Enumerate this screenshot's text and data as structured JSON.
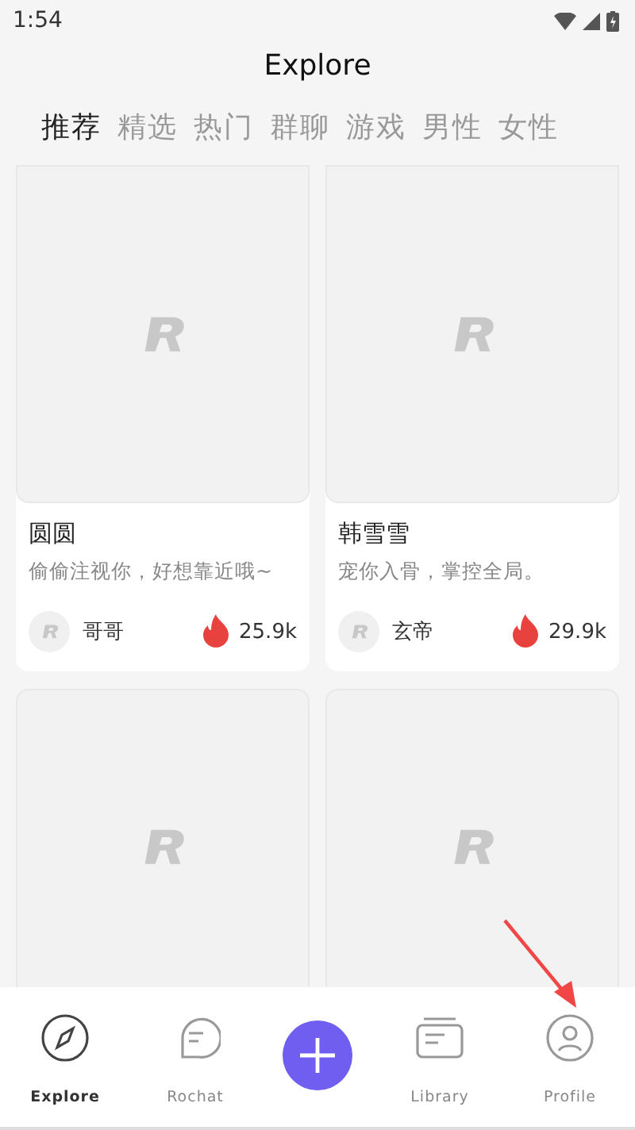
{
  "status_bar": {
    "time": "1:54"
  },
  "header": {
    "title": "Explore"
  },
  "tabs": [
    {
      "label": "推荐",
      "selected": true
    },
    {
      "label": "精选",
      "selected": false
    },
    {
      "label": "热门",
      "selected": false
    },
    {
      "label": "群聊",
      "selected": false
    },
    {
      "label": "游戏",
      "selected": false
    },
    {
      "label": "男性",
      "selected": false
    },
    {
      "label": "女性",
      "selected": false
    }
  ],
  "cards": [
    {
      "kind": "full",
      "title": "圆圆",
      "subtitle": "偷偷注视你，好想靠近哦~",
      "author": "哥哥",
      "count": "25.9k"
    },
    {
      "kind": "full",
      "title": "韩雪雪",
      "subtitle": "宠你入骨，掌控全局。",
      "author": "玄帝",
      "count": "29.9k"
    },
    {
      "kind": "image_only"
    },
    {
      "kind": "image_only"
    }
  ],
  "nav": [
    {
      "kind": "compass",
      "label": "Explore",
      "selected": true
    },
    {
      "kind": "chat",
      "label": "Rochat",
      "selected": false
    },
    {
      "kind": "plus"
    },
    {
      "kind": "library",
      "label": "Library",
      "selected": false
    },
    {
      "kind": "profile",
      "label": "Profile",
      "selected": false
    }
  ]
}
